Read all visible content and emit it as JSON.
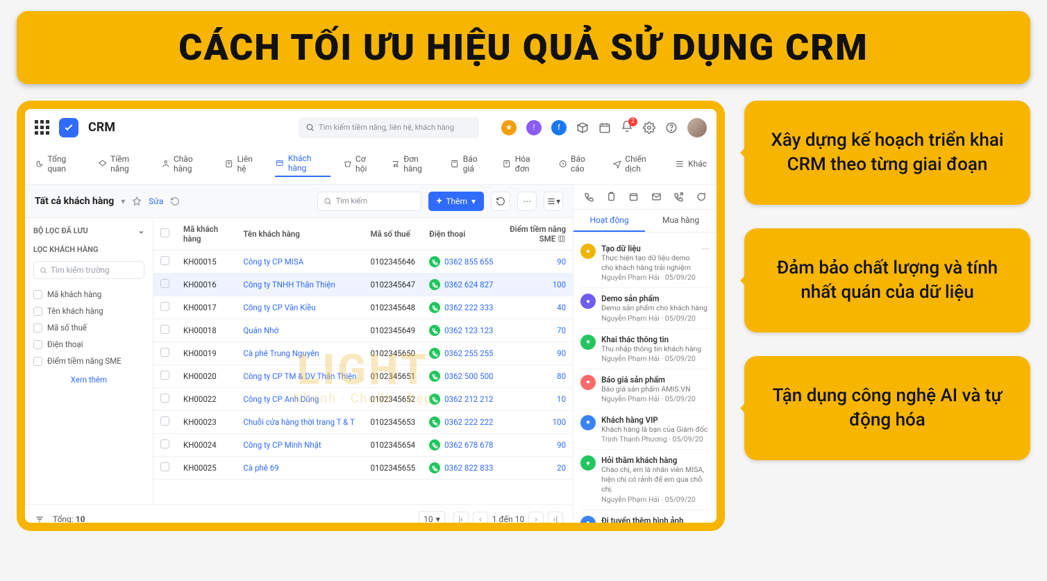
{
  "banner_title": "CÁCH TỐI ƯU HIỆU QUẢ SỬ DỤNG CRM",
  "app_name": "CRM",
  "top_search_placeholder": "Tìm kiếm tiềm năng, liên hệ, khách hàng",
  "bell_badge": "2",
  "nav": [
    {
      "label": "Tổng quan"
    },
    {
      "label": "Tiềm năng"
    },
    {
      "label": "Chào hàng"
    },
    {
      "label": "Liên hệ"
    },
    {
      "label": "Khách hàng"
    },
    {
      "label": "Cơ hội"
    },
    {
      "label": "Đơn hàng"
    },
    {
      "label": "Báo giá"
    },
    {
      "label": "Hóa đơn"
    },
    {
      "label": "Báo cáo"
    },
    {
      "label": "Chiến dịch"
    },
    {
      "label": "Khác"
    }
  ],
  "page_title": "Tất cả khách hàng",
  "edit_label": "Sửa",
  "inner_search_placeholder": "Tìm kiếm",
  "add_button_label": "Thêm",
  "sidebar": {
    "saved_filter_title": "BỘ LỌC ĐÃ LƯU",
    "filter_customers_title": "LỌC KHÁCH HÀNG",
    "field_search_placeholder": "Tìm kiếm trường",
    "checks": [
      "Mã khách hàng",
      "Tên khách hàng",
      "Mã số thuế",
      "Điện thoại",
      "Điểm tiềm năng SME"
    ],
    "show_more": "Xem thêm"
  },
  "columns": [
    "Mã khách hàng",
    "Tên khách hàng",
    "Mã số thuế",
    "Điện thoại",
    "Điểm tiềm năng SME"
  ],
  "rows": [
    {
      "code": "KH00015",
      "name": "Công ty CP MISA",
      "tax": "0102345646",
      "phone": "0362 855 655",
      "score": "90"
    },
    {
      "code": "KH00016",
      "name": "Công ty TNHH Thân Thiện",
      "tax": "0102345647",
      "phone": "0362 624 827",
      "score": "100",
      "selected": true
    },
    {
      "code": "KH00017",
      "name": "Công ty CP Văn Kiều",
      "tax": "0102345648",
      "phone": "0362 222 333",
      "score": "40"
    },
    {
      "code": "KH00018",
      "name": "Quán Nhớ",
      "tax": "0102345649",
      "phone": "0362 123 123",
      "score": "70"
    },
    {
      "code": "KH00019",
      "name": "Cà phê Trung Nguyên",
      "tax": "0102345650",
      "phone": "0362 255 255",
      "score": "90"
    },
    {
      "code": "KH00020",
      "name": "Công ty CP TM & DV Thân Thiện",
      "tax": "0102345651",
      "phone": "0362 500 500",
      "score": "80"
    },
    {
      "code": "KH00022",
      "name": "Công ty CP Anh Dũng",
      "tax": "0102345652",
      "phone": "0362 212 212",
      "score": "10"
    },
    {
      "code": "KH00023",
      "name": "Chuỗi cửa hàng thời trang T & T",
      "tax": "0102345653",
      "phone": "0362 222 222",
      "score": "100"
    },
    {
      "code": "KH00024",
      "name": "Công ty CP Minh Nhật",
      "tax": "0102345654",
      "phone": "0362 678 678",
      "score": "90"
    },
    {
      "code": "KH00025",
      "name": "Cà phê 69",
      "tax": "0102345655",
      "phone": "0362 822 833",
      "score": "20"
    }
  ],
  "footer": {
    "total_label": "Tổng:",
    "total_value": "10",
    "page_size": "10",
    "range": "1 đến 10"
  },
  "right_panel": {
    "tabs": {
      "activity": "Hoạt động",
      "purchase": "Mua hàng"
    },
    "activities": [
      {
        "color": "#f0b400",
        "title": "Tạo dữ liệu",
        "sub": "Thực hiện tạo dữ liệu demo cho khách hàng trải nghiệm",
        "meta": "Nguyễn Phạm Hải · 05/09/20",
        "dots": true
      },
      {
        "color": "#6f5cf1",
        "title": "Demo sản phẩm",
        "sub": "Demo sản phẩm cho khách hàng",
        "meta": "Nguyễn Phạm Hải · 05/09/20"
      },
      {
        "color": "#22c55e",
        "title": "Khai thác thông tin",
        "sub": "Thu nhập thông tin khách hàng",
        "meta": "Nguyễn Phạm Hải · 05/09/20"
      },
      {
        "color": "#ff6b6b",
        "title": "Báo giá sản phẩm",
        "sub": "Báo giá sản phẩm AMIS.VN",
        "meta": "Nguyễn Phạm Hải · 05/09/20"
      },
      {
        "color": "#3b82f6",
        "title": "Khách hàng VIP",
        "sub": "Khách hàng là bạn của Giám đốc",
        "meta": "Trịnh Thanh Phương · 05/09/20"
      },
      {
        "color": "#22c55e",
        "title": "Hỏi thăm khách hàng",
        "sub": "Chào chị, em là nhân viên MISA, hiện chị có rảnh để em qua chỗ chị.",
        "meta": "Nguyễn Phạm Hải · 05/09/20"
      },
      {
        "color": "#3b82f6",
        "title": "Đi tuyển thêm hình ảnh",
        "sub": "",
        "meta": ""
      }
    ]
  },
  "watermark": {
    "line1": "LIGHT",
    "line2": "Nhanh · Chuẩn · Đẹp"
  },
  "cards": [
    "Xây dựng kế hoạch triển khai CRM theo từng giai đoạn",
    "Đảm bảo chất lượng và tính nhất quán của dữ liệu",
    "Tận dụng công nghệ AI và tự động hóa"
  ]
}
